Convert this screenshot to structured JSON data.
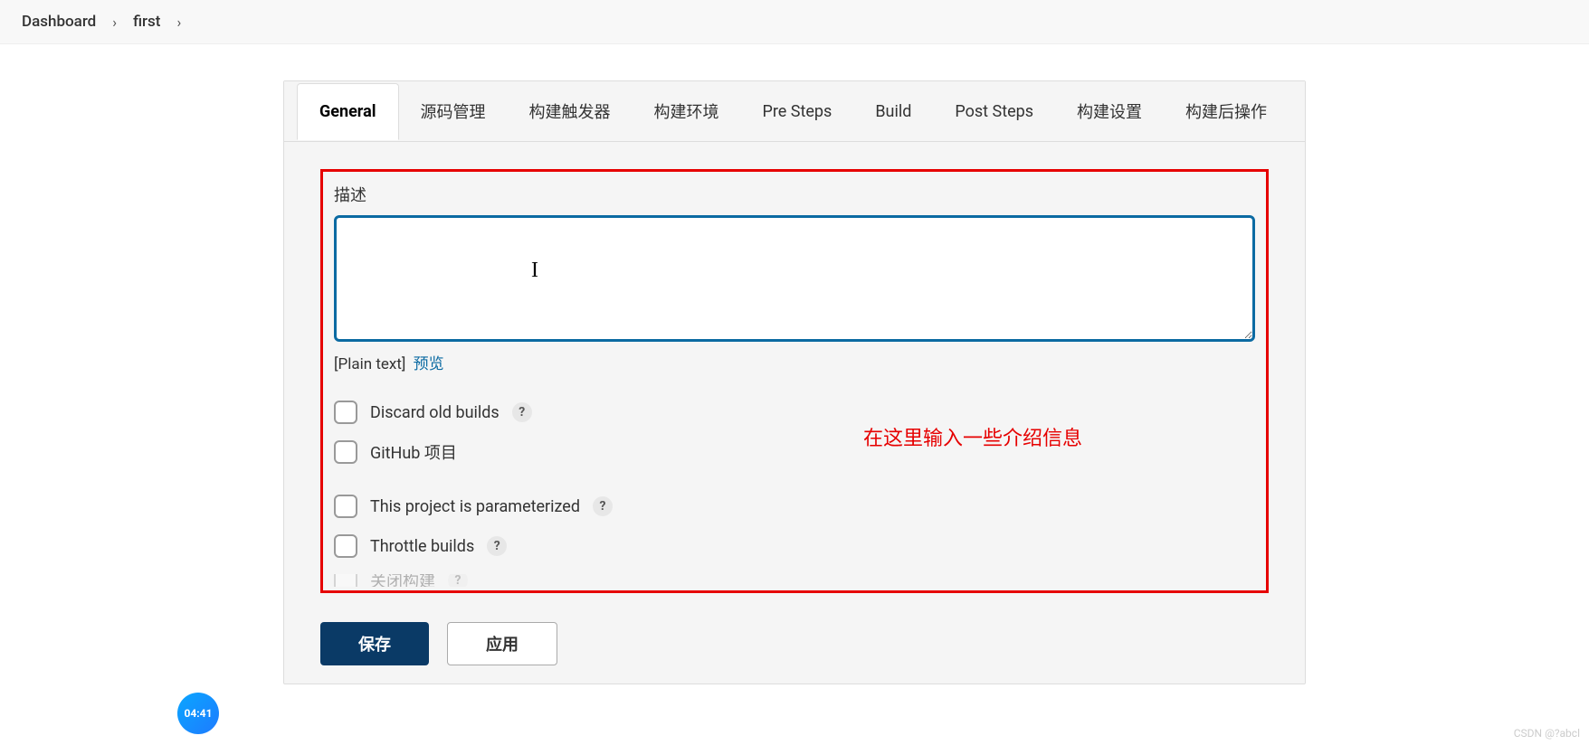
{
  "breadcrumb": {
    "items": [
      "Dashboard",
      "first"
    ]
  },
  "tabs": {
    "items": [
      {
        "label": "General",
        "active": true
      },
      {
        "label": "源码管理"
      },
      {
        "label": "构建触发器"
      },
      {
        "label": "构建环境"
      },
      {
        "label": "Pre Steps"
      },
      {
        "label": "Build"
      },
      {
        "label": "Post Steps"
      },
      {
        "label": "构建设置"
      },
      {
        "label": "构建后操作"
      }
    ]
  },
  "form": {
    "description_label": "描述",
    "description_value": "",
    "plain_text_label": "[Plain text]",
    "preview_label": "预览",
    "checkboxes": [
      {
        "label": "Discard old builds",
        "help": true
      },
      {
        "label": "GitHub 项目",
        "help": false,
        "gap_after": true
      },
      {
        "label": "This project is parameterized",
        "help": true
      },
      {
        "label": "Throttle builds",
        "help": true
      },
      {
        "label": "关闭构建",
        "help": true,
        "clipped": true
      }
    ],
    "help_glyph": "?"
  },
  "annotation": "在这里输入一些介绍信息",
  "buttons": {
    "save": "保存",
    "apply": "应用"
  },
  "badge": {
    "time": "04:41"
  },
  "watermark": "CSDN @?abcl"
}
